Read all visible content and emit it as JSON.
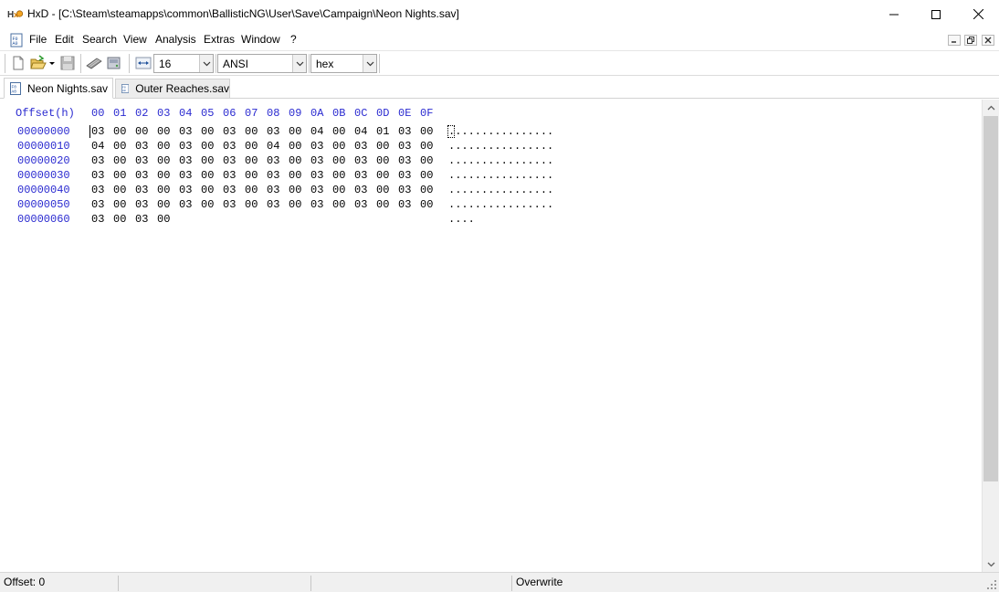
{
  "window": {
    "title": "HxD - [C:\\Steam\\steamapps\\common\\BallisticNG\\User\\Save\\Campaign\\Neon Nights.sav]"
  },
  "menu": {
    "items": [
      "File",
      "Edit",
      "Search",
      "View",
      "Analysis",
      "Extras",
      "Window",
      "?"
    ]
  },
  "toolbar": {
    "bytes_per_row": "16",
    "charset": "ANSI",
    "offset_base": "hex"
  },
  "tabs": [
    {
      "label": "Neon Nights.sav",
      "active": true
    },
    {
      "label": "Outer Reaches.sav",
      "active": false
    }
  ],
  "editor": {
    "offset_header": "Offset(h)",
    "columns": [
      "00",
      "01",
      "02",
      "03",
      "04",
      "05",
      "06",
      "07",
      "08",
      "09",
      "0A",
      "0B",
      "0C",
      "0D",
      "0E",
      "0F"
    ],
    "rows": [
      {
        "offset": "00000000",
        "bytes": [
          "03",
          "00",
          "00",
          "00",
          "03",
          "00",
          "03",
          "00",
          "03",
          "00",
          "04",
          "00",
          "04",
          "01",
          "03",
          "00"
        ],
        "ascii": "................"
      },
      {
        "offset": "00000010",
        "bytes": [
          "04",
          "00",
          "03",
          "00",
          "03",
          "00",
          "03",
          "00",
          "04",
          "00",
          "03",
          "00",
          "03",
          "00",
          "03",
          "00"
        ],
        "ascii": "................"
      },
      {
        "offset": "00000020",
        "bytes": [
          "03",
          "00",
          "03",
          "00",
          "03",
          "00",
          "03",
          "00",
          "03",
          "00",
          "03",
          "00",
          "03",
          "00",
          "03",
          "00"
        ],
        "ascii": "................"
      },
      {
        "offset": "00000030",
        "bytes": [
          "03",
          "00",
          "03",
          "00",
          "03",
          "00",
          "03",
          "00",
          "03",
          "00",
          "03",
          "00",
          "03",
          "00",
          "03",
          "00"
        ],
        "ascii": "................"
      },
      {
        "offset": "00000040",
        "bytes": [
          "03",
          "00",
          "03",
          "00",
          "03",
          "00",
          "03",
          "00",
          "03",
          "00",
          "03",
          "00",
          "03",
          "00",
          "03",
          "00"
        ],
        "ascii": "................"
      },
      {
        "offset": "00000050",
        "bytes": [
          "03",
          "00",
          "03",
          "00",
          "03",
          "00",
          "03",
          "00",
          "03",
          "00",
          "03",
          "00",
          "03",
          "00",
          "03",
          "00"
        ],
        "ascii": "................"
      },
      {
        "offset": "00000060",
        "bytes": [
          "03",
          "00",
          "03",
          "00"
        ],
        "ascii": "...."
      }
    ]
  },
  "status": {
    "offset": "Offset: 0",
    "mode": "Overwrite"
  }
}
